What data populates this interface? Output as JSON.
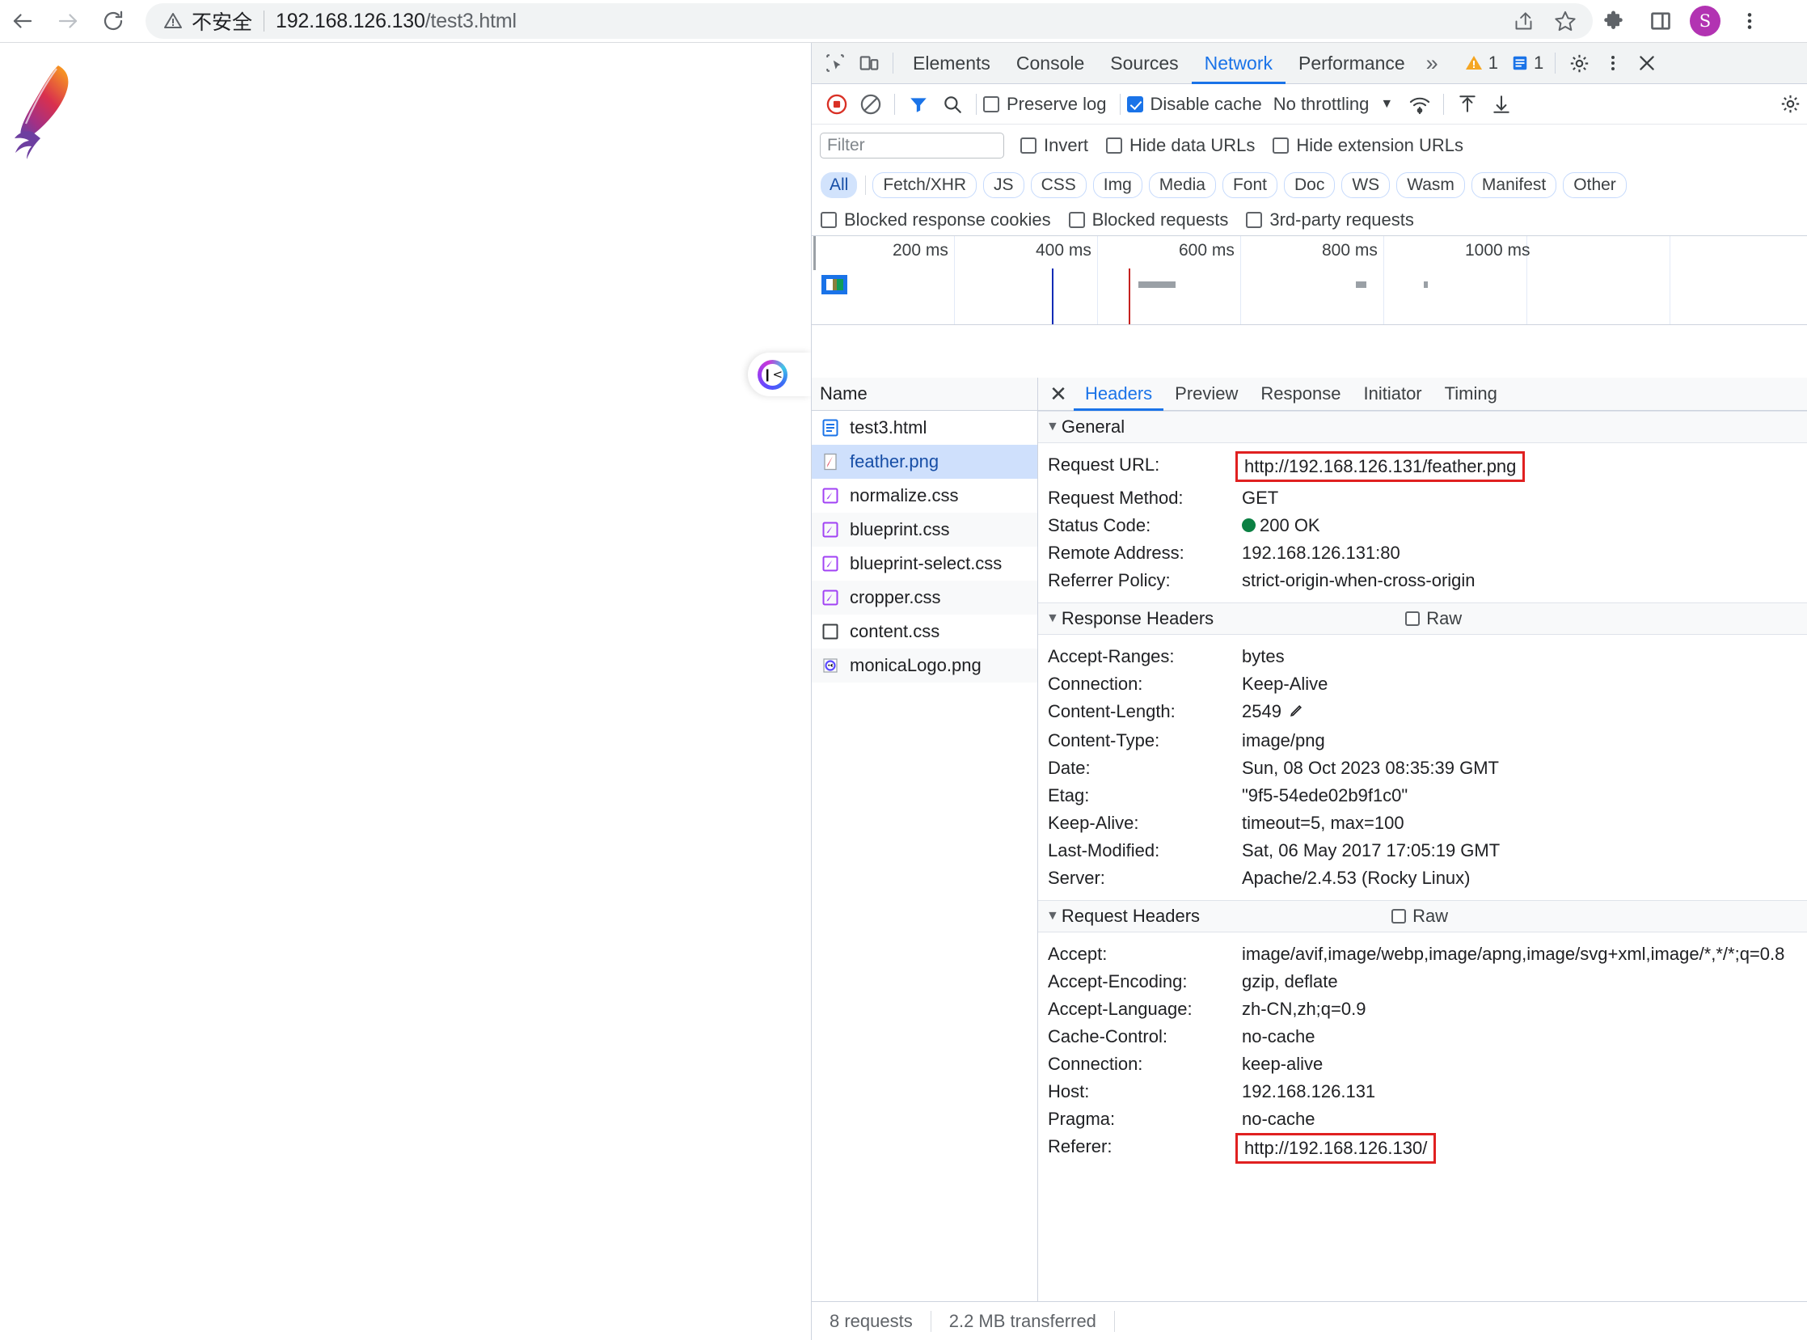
{
  "browser": {
    "back_label": "Back",
    "forward_label": "Forward",
    "reload_label": "Reload",
    "security_text": "不安全",
    "url_host": "192.168.126.130",
    "url_path": "/test3.html",
    "share_label": "Share this page",
    "bookmark_label": "Bookmark this tab",
    "extensions_label": "Extensions",
    "sidepanel_label": "Side panel",
    "profile_initial": "S",
    "menu_label": "Customize and control Google Chrome"
  },
  "page": {
    "logo_alt": "Apache feather logo",
    "monica_alt": "Monica assistant"
  },
  "devtools": {
    "tabs": [
      {
        "label": "Elements",
        "active": false
      },
      {
        "label": "Console",
        "active": false
      },
      {
        "label": "Sources",
        "active": false
      },
      {
        "label": "Network",
        "active": true
      },
      {
        "label": "Performance",
        "active": false
      }
    ],
    "more_tabs": "»",
    "warning_count": "1",
    "message_count": "1",
    "settings_label": "Settings",
    "dots_label": "More options",
    "close_label": "Close DevTools",
    "toolbar": {
      "record_label": "Stop recording network log",
      "clear_label": "Clear network log",
      "filter_label": "Filter",
      "search_label": "Search",
      "preserve_log": "Preserve log",
      "preserve_log_checked": false,
      "disable_cache": "Disable cache",
      "disable_cache_checked": true,
      "throttling_value": "No throttling",
      "throttling_caret": "▼",
      "network_conditions_label": "Network conditions",
      "import_label": "Import HAR file",
      "export_label": "Export HAR file",
      "capture_settings_label": "Network settings"
    },
    "filters": {
      "filter_placeholder": "Filter",
      "filter_value": "",
      "invert": "Invert",
      "invert_checked": false,
      "hide_data_urls": "Hide data URLs",
      "hide_data_urls_checked": false,
      "hide_extension_urls": "Hide extension URLs",
      "hide_extension_urls_checked": false,
      "types": [
        {
          "label": "All",
          "active": true
        },
        {
          "label": "Fetch/XHR",
          "active": false
        },
        {
          "label": "JS",
          "active": false
        },
        {
          "label": "CSS",
          "active": false
        },
        {
          "label": "Img",
          "active": false
        },
        {
          "label": "Media",
          "active": false
        },
        {
          "label": "Font",
          "active": false
        },
        {
          "label": "Doc",
          "active": false
        },
        {
          "label": "WS",
          "active": false
        },
        {
          "label": "Wasm",
          "active": false
        },
        {
          "label": "Manifest",
          "active": false
        },
        {
          "label": "Other",
          "active": false
        }
      ],
      "blocked_response_cookies": "Blocked response cookies",
      "blocked_response_cookies_checked": false,
      "blocked_requests": "Blocked requests",
      "blocked_requests_checked": false,
      "third_party_requests": "3rd-party requests",
      "third_party_requests_checked": false
    },
    "overview": {
      "ticks": [
        "200 ms",
        "400 ms",
        "600 ms",
        "800 ms",
        "1000 ms"
      ],
      "dom_content_loaded_color": "#0d2bb5",
      "load_event_color": "#c5221f"
    },
    "requests": {
      "column_header": "Name",
      "items": [
        {
          "name": "test3.html",
          "icon": "document-icon",
          "selected": false
        },
        {
          "name": "feather.png",
          "icon": "image-icon",
          "selected": true
        },
        {
          "name": "normalize.css",
          "icon": "stylesheet-icon",
          "selected": false
        },
        {
          "name": "blueprint.css",
          "icon": "stylesheet-icon",
          "selected": false
        },
        {
          "name": "blueprint-select.css",
          "icon": "stylesheet-icon",
          "selected": false
        },
        {
          "name": "cropper.css",
          "icon": "stylesheet-icon",
          "selected": false
        },
        {
          "name": "content.css",
          "icon": "generic-icon",
          "selected": false
        },
        {
          "name": "monicaLogo.png",
          "icon": "image-icon",
          "selected": false
        }
      ]
    },
    "detail": {
      "close_label": "✕",
      "tabs": [
        {
          "label": "Headers",
          "active": true
        },
        {
          "label": "Preview",
          "active": false
        },
        {
          "label": "Response",
          "active": false
        },
        {
          "label": "Initiator",
          "active": false
        },
        {
          "label": "Timing",
          "active": false
        }
      ],
      "general": {
        "title": "General",
        "rows": [
          {
            "key": "Request URL:",
            "value": "http://192.168.126.131/feather.png",
            "highlight": true
          },
          {
            "key": "Request Method:",
            "value": "GET"
          },
          {
            "key": "Status Code:",
            "value": "200 OK",
            "status_dot": true
          },
          {
            "key": "Remote Address:",
            "value": "192.168.126.131:80"
          },
          {
            "key": "Referrer Policy:",
            "value": "strict-origin-when-cross-origin"
          }
        ]
      },
      "response_headers": {
        "title": "Response Headers",
        "raw_label": "Raw",
        "raw_checked": false,
        "rows": [
          {
            "key": "Accept-Ranges:",
            "value": "bytes"
          },
          {
            "key": "Connection:",
            "value": "Keep-Alive"
          },
          {
            "key": "Content-Length:",
            "value": "2549",
            "pencil": true
          },
          {
            "key": "Content-Type:",
            "value": "image/png"
          },
          {
            "key": "Date:",
            "value": "Sun, 08 Oct 2023 08:35:39 GMT"
          },
          {
            "key": "Etag:",
            "value": "\"9f5-54ede02b9f1c0\""
          },
          {
            "key": "Keep-Alive:",
            "value": "timeout=5, max=100"
          },
          {
            "key": "Last-Modified:",
            "value": "Sat, 06 May 2017 17:05:19 GMT"
          },
          {
            "key": "Server:",
            "value": "Apache/2.4.53 (Rocky Linux)"
          }
        ]
      },
      "request_headers": {
        "title": "Request Headers",
        "raw_label": "Raw",
        "raw_checked": false,
        "rows": [
          {
            "key": "Accept:",
            "value": "image/avif,image/webp,image/apng,image/svg+xml,image/*,*/*;q=0.8",
            "wrap": true
          },
          {
            "key": "Accept-Encoding:",
            "value": "gzip, deflate"
          },
          {
            "key": "Accept-Language:",
            "value": "zh-CN,zh;q=0.9"
          },
          {
            "key": "Cache-Control:",
            "value": "no-cache"
          },
          {
            "key": "Connection:",
            "value": "keep-alive"
          },
          {
            "key": "Host:",
            "value": "192.168.126.131"
          },
          {
            "key": "Pragma:",
            "value": "no-cache"
          },
          {
            "key": "Referer:",
            "value": "http://192.168.126.130/",
            "highlight": true
          }
        ]
      }
    },
    "status_bar": {
      "requests": "8 requests",
      "transferred": "2.2 MB transferred"
    }
  }
}
